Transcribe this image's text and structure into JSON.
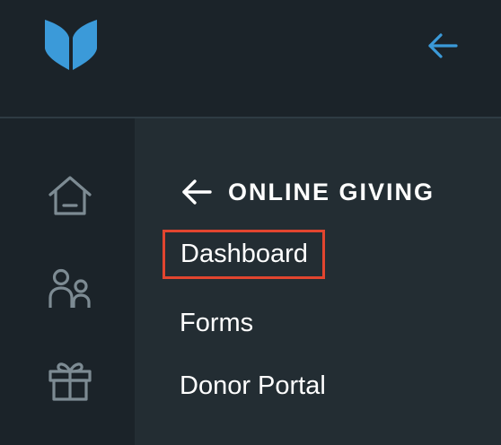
{
  "colors": {
    "accent": "#3b9ad9",
    "icon_muted": "#7d8b93",
    "highlight_border": "#e2452f",
    "panel_bg": "#232d33",
    "rail_bg": "#1b2329"
  },
  "header": {
    "logo_icon": "book-leaf-logo",
    "collapse_icon": "arrow-left-icon"
  },
  "rail": {
    "items": [
      {
        "icon": "home-icon"
      },
      {
        "icon": "people-icon"
      },
      {
        "icon": "gift-icon"
      }
    ]
  },
  "panel": {
    "back_icon": "arrow-left-icon",
    "title": "ONLINE GIVING",
    "links": [
      {
        "label": "Dashboard",
        "active": true
      },
      {
        "label": "Forms",
        "active": false
      },
      {
        "label": "Donor Portal",
        "active": false
      }
    ]
  }
}
